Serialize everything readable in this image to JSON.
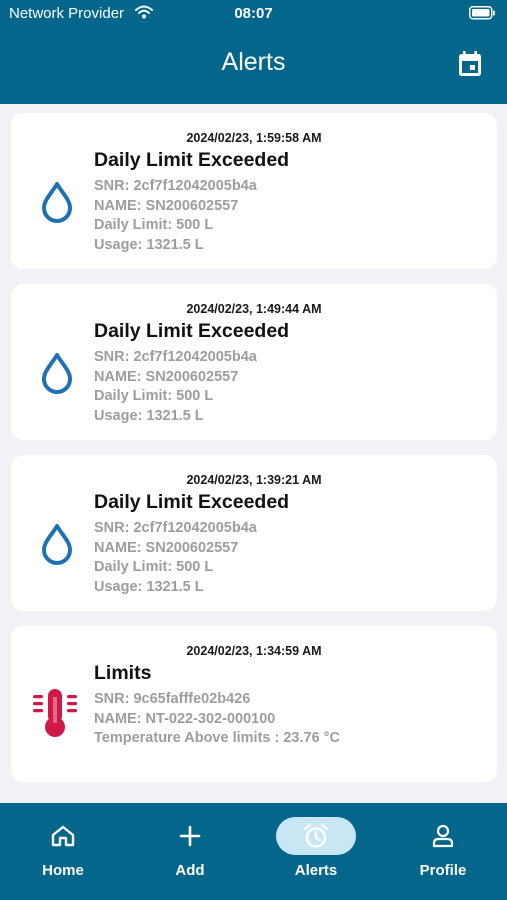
{
  "status_bar": {
    "carrier": "Network Provider",
    "time": "08:07"
  },
  "header": {
    "title": "Alerts"
  },
  "alerts": [
    {
      "timestamp": "2024/02/23, 1:59:58 AM",
      "title": "Daily Limit Exceeded",
      "icon": "water-drop-icon",
      "lines": [
        "SNR: 2cf7f12042005b4a",
        "NAME: SN200602557",
        "Daily Limit: 500 L",
        "Usage: 1321.5 L"
      ]
    },
    {
      "timestamp": "2024/02/23, 1:49:44 AM",
      "title": "Daily Limit Exceeded",
      "icon": "water-drop-icon",
      "lines": [
        "SNR: 2cf7f12042005b4a",
        "NAME: SN200602557",
        "Daily Limit: 500 L",
        "Usage: 1321.5 L"
      ]
    },
    {
      "timestamp": "2024/02/23, 1:39:21 AM",
      "title": "Daily Limit Exceeded",
      "icon": "water-drop-icon",
      "lines": [
        "SNR: 2cf7f12042005b4a",
        "NAME: SN200602557",
        "Daily Limit: 500 L",
        "Usage: 1321.5 L"
      ]
    },
    {
      "timestamp": "2024/02/23, 1:34:59 AM",
      "title": "Limits",
      "icon": "thermometer-icon",
      "lines": [
        "SNR: 9c65fafffe02b426",
        "NAME: NT-022-302-000100",
        "Temperature Above limits : 23.76 °C"
      ]
    }
  ],
  "tabs": [
    {
      "label": "Home",
      "icon": "home-icon",
      "active": false
    },
    {
      "label": "Add",
      "icon": "plus-icon",
      "active": false
    },
    {
      "label": "Alerts",
      "icon": "alarm-clock-icon",
      "active": true
    },
    {
      "label": "Profile",
      "icon": "person-icon",
      "active": false
    }
  ],
  "colors": {
    "brand": "#03668a",
    "active_tab_bg": "#c9e6f5",
    "drop": "#1e72b4",
    "thermometer": "#d0174a"
  }
}
